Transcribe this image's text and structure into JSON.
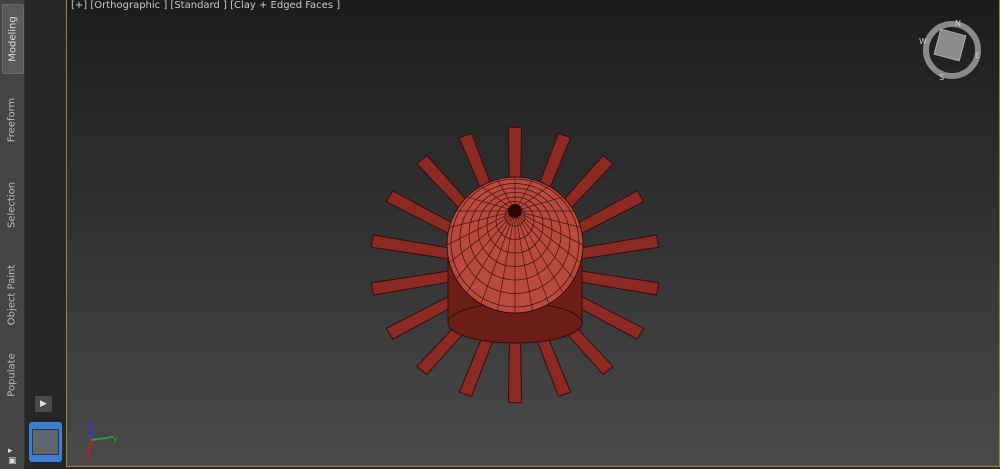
{
  "ribbon": {
    "tabs": [
      {
        "label": "Modeling",
        "active": true
      },
      {
        "label": "Freeform"
      },
      {
        "label": "Selection"
      },
      {
        "label": "Object Paint"
      },
      {
        "label": "Populate"
      }
    ]
  },
  "viewport": {
    "label": "[+] [Orthographic ] [Standard ] [Clay + Edged Faces ]",
    "object_color": "#8a2a22",
    "border_color": "#9a8230"
  },
  "axis": {
    "x": "x",
    "y": "y",
    "z": "z"
  },
  "viewcube": {
    "n": "N",
    "e": "E",
    "s": "S",
    "w": "W"
  },
  "icons": {
    "play": "play-icon",
    "viewcube": "viewcube-icon"
  }
}
